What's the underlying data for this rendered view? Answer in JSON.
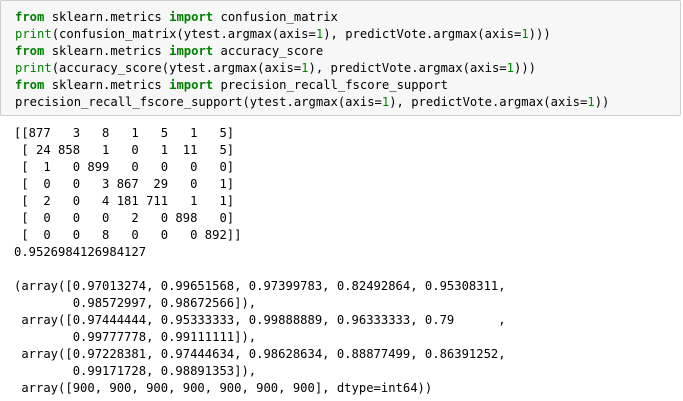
{
  "code_cell": {
    "lines": [
      [
        {
          "t": "kw",
          "v": "from"
        },
        {
          "t": "tx",
          "v": " sklearn.metrics "
        },
        {
          "t": "kw",
          "v": "import"
        },
        {
          "t": "tx",
          "v": " confusion_matrix"
        }
      ],
      [
        {
          "t": "bi",
          "v": "print"
        },
        {
          "t": "tx",
          "v": "(confusion_matrix(ytest.argmax(axis="
        },
        {
          "t": "num",
          "v": "1"
        },
        {
          "t": "tx",
          "v": "), predictVote.argmax(axis="
        },
        {
          "t": "num",
          "v": "1"
        },
        {
          "t": "tx",
          "v": ")))"
        }
      ],
      [
        {
          "t": "kw",
          "v": "from"
        },
        {
          "t": "tx",
          "v": " sklearn.metrics "
        },
        {
          "t": "kw",
          "v": "import"
        },
        {
          "t": "tx",
          "v": " accuracy_score"
        }
      ],
      [
        {
          "t": "bi",
          "v": "print"
        },
        {
          "t": "tx",
          "v": "(accuracy_score(ytest.argmax(axis="
        },
        {
          "t": "num",
          "v": "1"
        },
        {
          "t": "tx",
          "v": "), predictVote.argmax(axis="
        },
        {
          "t": "num",
          "v": "1"
        },
        {
          "t": "tx",
          "v": ")))"
        }
      ],
      [
        {
          "t": "kw",
          "v": "from"
        },
        {
          "t": "tx",
          "v": " sklearn.metrics "
        },
        {
          "t": "kw",
          "v": "import"
        },
        {
          "t": "tx",
          "v": " precision_recall_fscore_support"
        }
      ],
      [
        {
          "t": "tx",
          "v": "precision_recall_fscore_support(ytest.argmax(axis="
        },
        {
          "t": "num",
          "v": "1"
        },
        {
          "t": "tx",
          "v": "), predictVote.argmax(axis="
        },
        {
          "t": "num",
          "v": "1"
        },
        {
          "t": "tx",
          "v": "))"
        }
      ]
    ]
  },
  "output": {
    "lines": [
      "[[877   3   8   1   5   1   5]",
      " [ 24 858   1   0   1  11   5]",
      " [  1   0 899   0   0   0   0]",
      " [  0   0   3 867  29   0   1]",
      " [  2   0   4 181 711   1   1]",
      " [  0   0   0   2   0 898   0]",
      " [  0   0   8   0   0   0 892]]",
      "0.9526984126984127",
      "",
      "(array([0.97013274, 0.99651568, 0.97399783, 0.82492864, 0.95308311,",
      "        0.98572997, 0.98672566]),",
      " array([0.97444444, 0.95333333, 0.99888889, 0.96333333, 0.79      ,",
      "        0.99777778, 0.99111111]),",
      " array([0.97228381, 0.97444634, 0.98628634, 0.88877499, 0.86391252,",
      "        0.99171728, 0.98891353]),",
      " array([900, 900, 900, 900, 900, 900, 900], dtype=int64))"
    ]
  },
  "colors": {
    "keyword": "#008000",
    "number": "#008800",
    "cell_bg": "#f7f7f7",
    "cell_border": "#cfcfcf"
  }
}
